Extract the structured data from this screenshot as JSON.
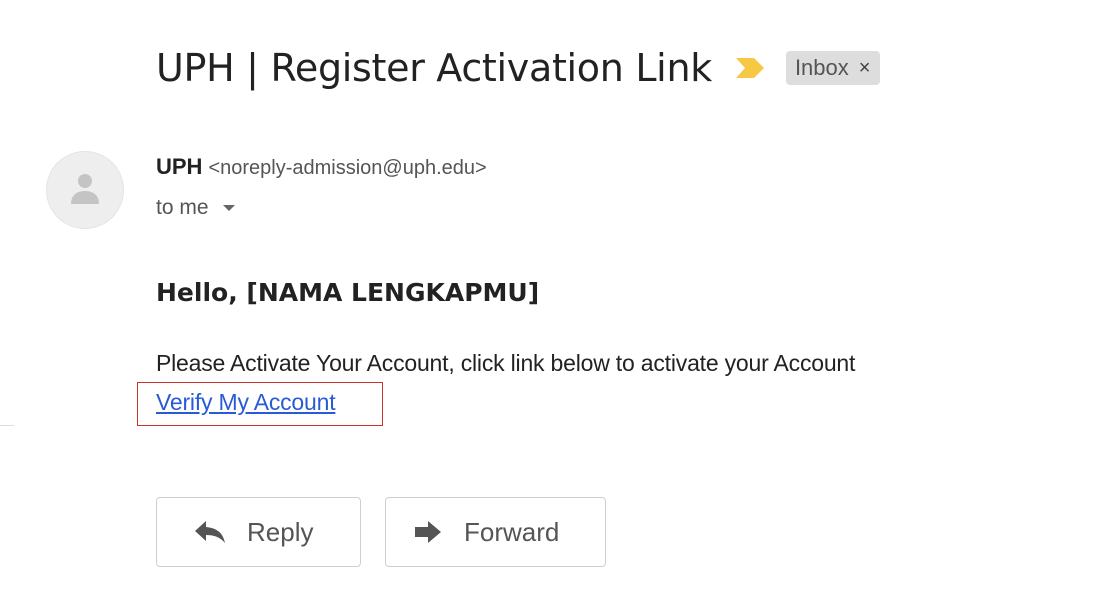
{
  "email": {
    "subject": "UPH | Register Activation Link",
    "label": "Inbox",
    "label_close": "×",
    "sender_name": "UPH",
    "sender_email": "<noreply-admission@uph.edu>",
    "recipient": "to me",
    "greeting": "Hello, [NAMA LENGKAPMU]",
    "body": "Please Activate Your Account, click link below to activate your Account",
    "link_text": "Verify My Account "
  },
  "actions": {
    "reply_label": "Reply",
    "forward_label": "Forward"
  },
  "icons": {
    "importance": "importance-marker-icon",
    "avatar": "person-icon",
    "reply": "reply-arrow-icon",
    "forward": "forward-arrow-icon"
  },
  "colors": {
    "importance_marker": "#f7c843",
    "link": "#2a5bd7",
    "highlight_box": "#d0312d",
    "label_chip_bg": "#dddddd"
  }
}
